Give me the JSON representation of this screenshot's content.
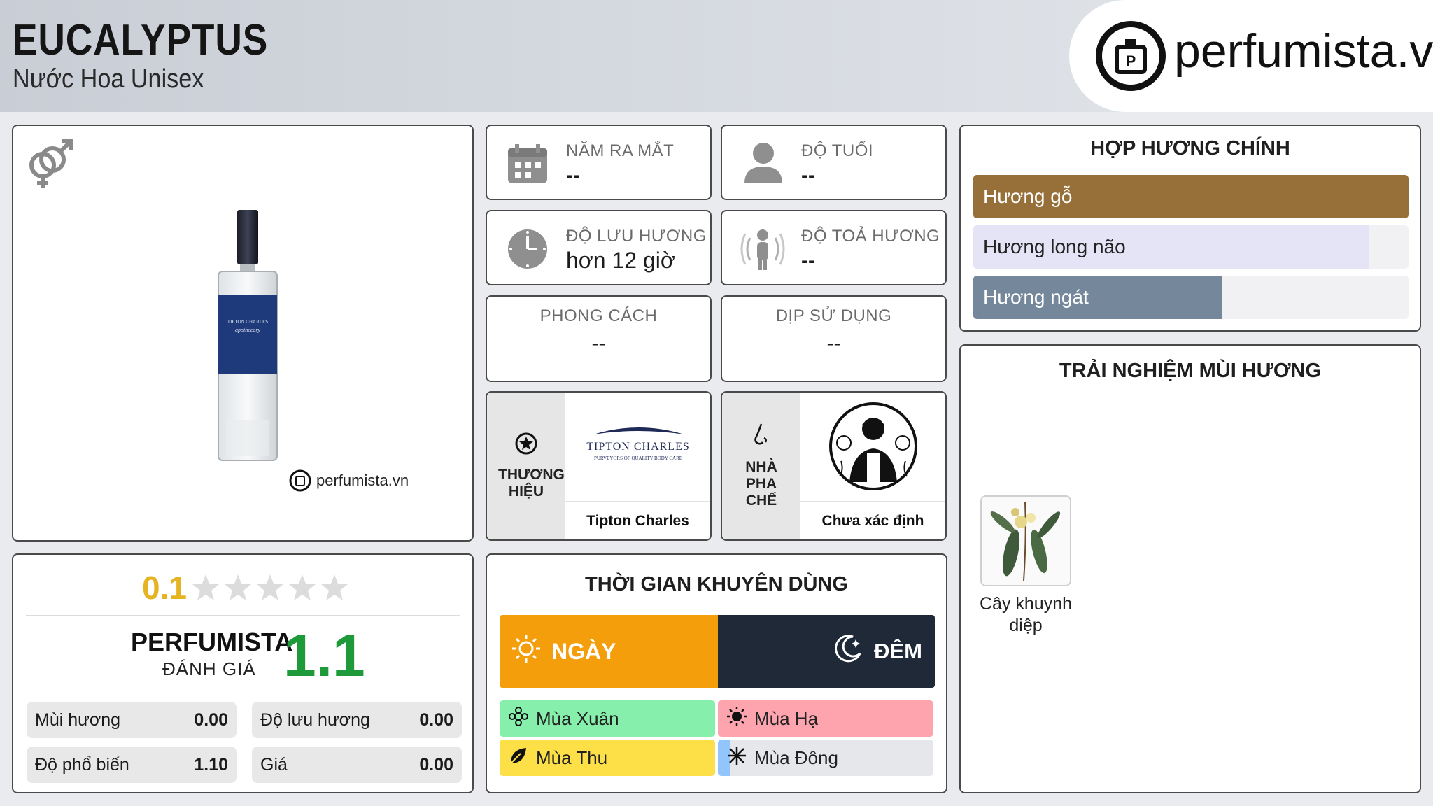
{
  "header": {
    "title": "EUCALYPTUS",
    "subtitle": "Nước Hoa Unisex",
    "brand": "perfumista.vn"
  },
  "product": {
    "watermark": "perfumista.vn",
    "bottle_label": "TIPTON CHARLES apothecary"
  },
  "info": {
    "launch_year": {
      "label": "NĂM RA MẮT",
      "value": "--"
    },
    "age": {
      "label": "ĐỘ TUỔI",
      "value": "--"
    },
    "longevity": {
      "label": "ĐỘ LƯU HƯƠNG",
      "value": "hơn 12 giờ"
    },
    "sillage": {
      "label": "ĐỘ TOẢ HƯƠNG",
      "value": "--"
    },
    "style": {
      "label": "PHONG CÁCH",
      "value": "--"
    },
    "occasion": {
      "label": "DỊP SỬ DỤNG",
      "value": "--"
    }
  },
  "brand_card": {
    "label": "THƯƠNG HIỆU",
    "logo_text": "TIPTON CHARLES",
    "logo_tagline": "PURVEYORS OF QUALITY BODY CARE",
    "name": "Tipton Charles"
  },
  "perfumer_card": {
    "label": "NHÀ PHA CHẾ",
    "name": "Chưa xác định"
  },
  "accords": {
    "title": "HỢP HƯƠNG CHÍNH",
    "items": [
      {
        "label": "Hương gỗ",
        "fraction": 1.0,
        "color": "#977039",
        "text_color": "#ffffff"
      },
      {
        "label": "Hương long não",
        "fraction": 0.91,
        "color": "#e4e4f6",
        "text_color": "#222222"
      },
      {
        "label": "Hương ngát",
        "fraction": 0.57,
        "color": "#74879b",
        "text_color": "#ffffff"
      }
    ]
  },
  "experience": {
    "title": "TRẢI NGHIỆM MÙI HƯƠNG",
    "notes": [
      {
        "label": "Cây khuynh diệp"
      }
    ]
  },
  "rating": {
    "user_score": "0.1",
    "stars_total": 5,
    "stars_filled": 0.02,
    "perfumista_label": "PERFUMISTA",
    "perfumista_sub": "ĐÁNH GIÁ",
    "perfumista_score": "1.1",
    "metrics": [
      {
        "label": "Mùi hương",
        "value": "0.00"
      },
      {
        "label": "Độ lưu hương",
        "value": "0.00"
      },
      {
        "label": "Độ phổ biến",
        "value": "1.10"
      },
      {
        "label": "Giá",
        "value": "0.00"
      }
    ]
  },
  "recommend": {
    "title": "THỜI GIAN KHUYÊN DÙNG",
    "day": "NGÀY",
    "night": "ĐÊM",
    "seasons": [
      {
        "label": "Mùa Xuân",
        "color": "#86efac",
        "fraction": 1.0
      },
      {
        "label": "Mùa Hạ",
        "color": "#fda4af",
        "fraction": 1.0
      },
      {
        "label": "Mùa Thu",
        "color": "#fde047",
        "fraction": 1.0
      },
      {
        "label": "Mùa Đông",
        "color": "#93c5fd",
        "fraction": 0.06
      }
    ]
  }
}
